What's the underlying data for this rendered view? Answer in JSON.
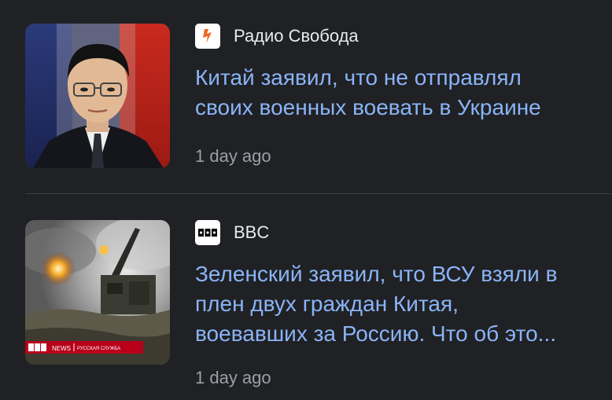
{
  "articles": [
    {
      "source": "Радио Свобода",
      "source_icon": "radio-svoboda-logo-icon",
      "headline_lines": [
        "Китай заявил, что не отправлял",
        "своих военных воевать в Украине"
      ],
      "time": "1 day ago",
      "thumbnail": "spokesperson-photo"
    },
    {
      "source": "BBC",
      "source_icon": "bbc-logo-icon",
      "headline_lines": [
        "Зеленский заявил, что ВСУ взяли в",
        "плен двух граждан Китая,",
        "воевавших за Россию. Что об это..."
      ],
      "time": "1 day ago",
      "thumbnail": "artillery-photo",
      "thumbnail_watermark": "BBC NEWS | РУССКАЯ СЛУЖБА"
    }
  ],
  "colors": {
    "background": "#202124",
    "headline": "#8ab4f8",
    "source_text": "#e8eaed",
    "timestamp": "#9aa0a6",
    "divider": "#3c4043",
    "radio_svoboda_accent": "#f26522"
  }
}
